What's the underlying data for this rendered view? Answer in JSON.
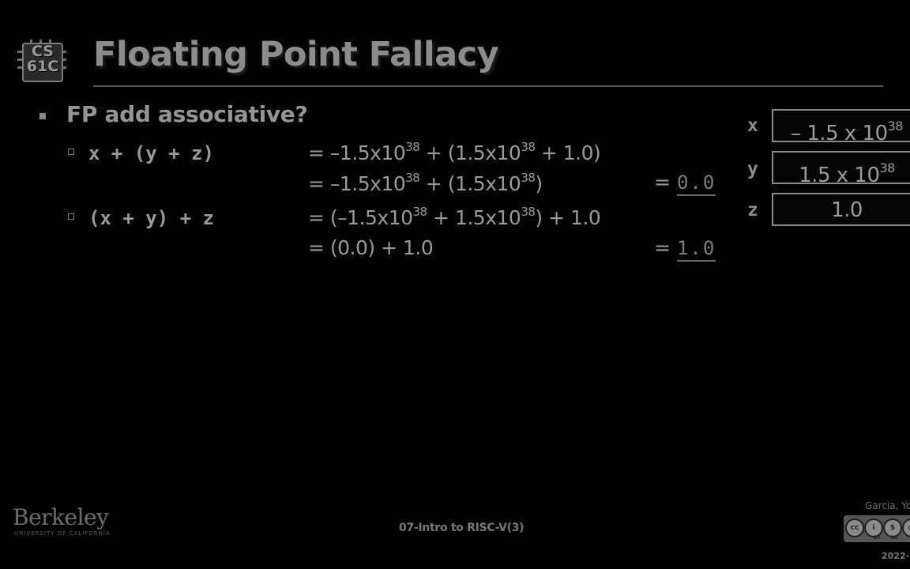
{
  "logo": {
    "line1": "CS",
    "line2": "61C"
  },
  "title": "Floating Point Fallacy",
  "bullet": "FP add associative?",
  "case1": {
    "expr": "x + (y + z)",
    "line1": {
      "a": "= –1.5x10",
      "a_exp": "38",
      "b": " + (1.5x10",
      "b_exp": "38",
      "c": " + 1.0)"
    },
    "line2": {
      "a": "= –1.5x10",
      "a_exp": "38",
      "b": " + (1.5x10",
      "b_exp": "38",
      "c": ")"
    },
    "result_eq": "=",
    "result": "0.0"
  },
  "case2": {
    "expr": "(x + y) + z",
    "line1": {
      "a": "= (–1.5x10",
      "a_exp": "38",
      "b": " + 1.5x10",
      "b_exp": "38",
      "c": ") + 1.0"
    },
    "line2": {
      "a": "= (0.0) + 1.0"
    },
    "result_eq": "=",
    "result": "1.0"
  },
  "variables": [
    {
      "name": "x",
      "value": "– 1.5 x 10",
      "exp": "38"
    },
    {
      "name": "y",
      "value": "1.5 x 10",
      "exp": "38"
    },
    {
      "name": "z",
      "value": "1.0",
      "exp": ""
    }
  ],
  "footer": {
    "berkeley": "Berkeley",
    "university": "UNIVERSITY OF CALIFORNIA",
    "center": "07-Intro to RISC-V(3)",
    "author": "Garcia, Yo",
    "license_labels": [
      "BY",
      "NC"
    ],
    "year": "2022-"
  }
}
